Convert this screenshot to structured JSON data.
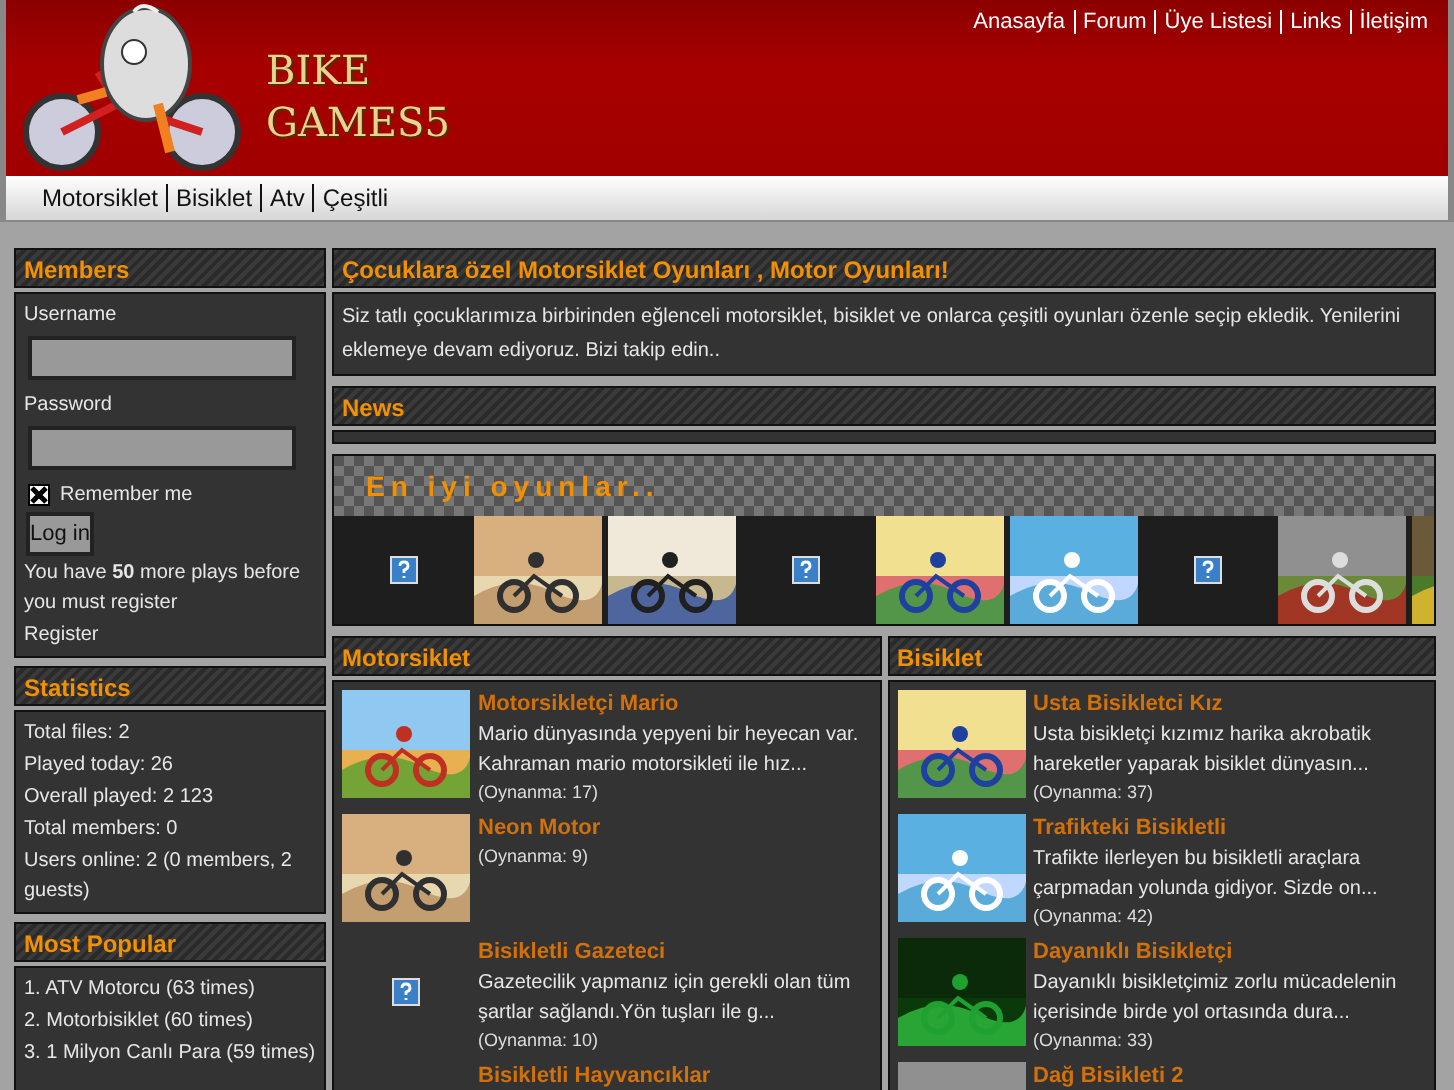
{
  "header": {
    "logo_lines": [
      "BIKE",
      "GAMES5"
    ],
    "links": [
      "Anasayfa",
      "Forum",
      "Üye Listesi",
      "Links",
      "İletişim"
    ]
  },
  "nav": [
    "Motorsiklet",
    "Bisiklet",
    "Atv",
    "Çeşitli"
  ],
  "members": {
    "title": "Members",
    "username_label": "Username",
    "password_label": "Password",
    "remember": {
      "label": "Remember me",
      "checked": true
    },
    "login": "Log in",
    "notice": "You have **50** more plays before you must register",
    "register": "Register"
  },
  "statistics": {
    "title": "Statistics",
    "lines": [
      "Total files: 2",
      "Played today: 26",
      "Overall played: 2 123",
      "Total members: 0",
      "Users online: 2 (0 members, 2 guests)"
    ]
  },
  "most_popular": {
    "title": "Most Popular",
    "items": [
      "1. ATV Motorcu (63 times)",
      "2. Motorbisiklet (60 times)",
      "3. 1 Milyon Canlı Para (59 times)"
    ]
  },
  "intro": {
    "title": "Çocuklara özel Motorsiklet Oyunları , Motor Oyunları!",
    "text": "Siz tatlı çocuklarımıza birbirinden eğlenceli motorsiklet, bisiklet ve onlarca çeşitli oyunları özenle seçip ekledik. Yenilerini eklemeye devam ediyoruz. Bizi takip edin.."
  },
  "news": {
    "title": "News"
  },
  "carousel": {
    "title": "En iyi oyunlar..",
    "items": [
      {
        "kind": "broken"
      },
      {
        "kind": "picture"
      },
      {
        "kind": "picture"
      },
      {
        "kind": "broken"
      },
      {
        "kind": "picture"
      },
      {
        "kind": "picture"
      },
      {
        "kind": "broken"
      },
      {
        "kind": "picture"
      },
      {
        "kind": "picture"
      }
    ]
  },
  "categories": [
    {
      "title": "Motorsiklet",
      "games": [
        {
          "kind": "picture",
          "title": "Motorsikletçi Mario",
          "description": "Mario dünyasında yepyeni bir heyecan var. Kahraman mario motorsikleti ile hız...",
          "plays": "(Oynanma: 17)"
        },
        {
          "kind": "picture",
          "title": "Neon Motor",
          "plays": "(Oynanma: 9)"
        },
        {
          "kind": "broken",
          "title": "Bisikletli Gazeteci",
          "description": "Gazetecilik yapmanız için gerekli olan tüm şartlar sağlandı.Yön tuşları ile g...",
          "plays": "(Oynanma: 10)"
        },
        {
          "kind": "none",
          "title": "Bisikletli Hayvancıklar"
        }
      ]
    },
    {
      "title": "Bisiklet",
      "games": [
        {
          "kind": "picture",
          "title": "Usta Bisikletci Kız",
          "description": "Usta bisikletçi kızımız harika akrobatik hareketler yaparak bisiklet dünyasın...",
          "plays": "(Oynanma: 37)"
        },
        {
          "kind": "picture",
          "title": "Trafikteki Bisikletli",
          "description": "Trafikte ilerleyen bu bisikletli araçlara çarpmadan yolunda gidiyor. Sizde on...",
          "plays": "(Oynanma: 42)"
        },
        {
          "kind": "picture",
          "title": "Dayanıklı Bisikletçi",
          "description": "Dayanıklı bisikletçimiz zorlu mücadelenin içerisinde birde yol ortasında dura...",
          "plays": "(Oynanma: 33)"
        },
        {
          "kind": "picture",
          "title": "Dağ Bisikleti 2"
        }
      ]
    }
  ]
}
